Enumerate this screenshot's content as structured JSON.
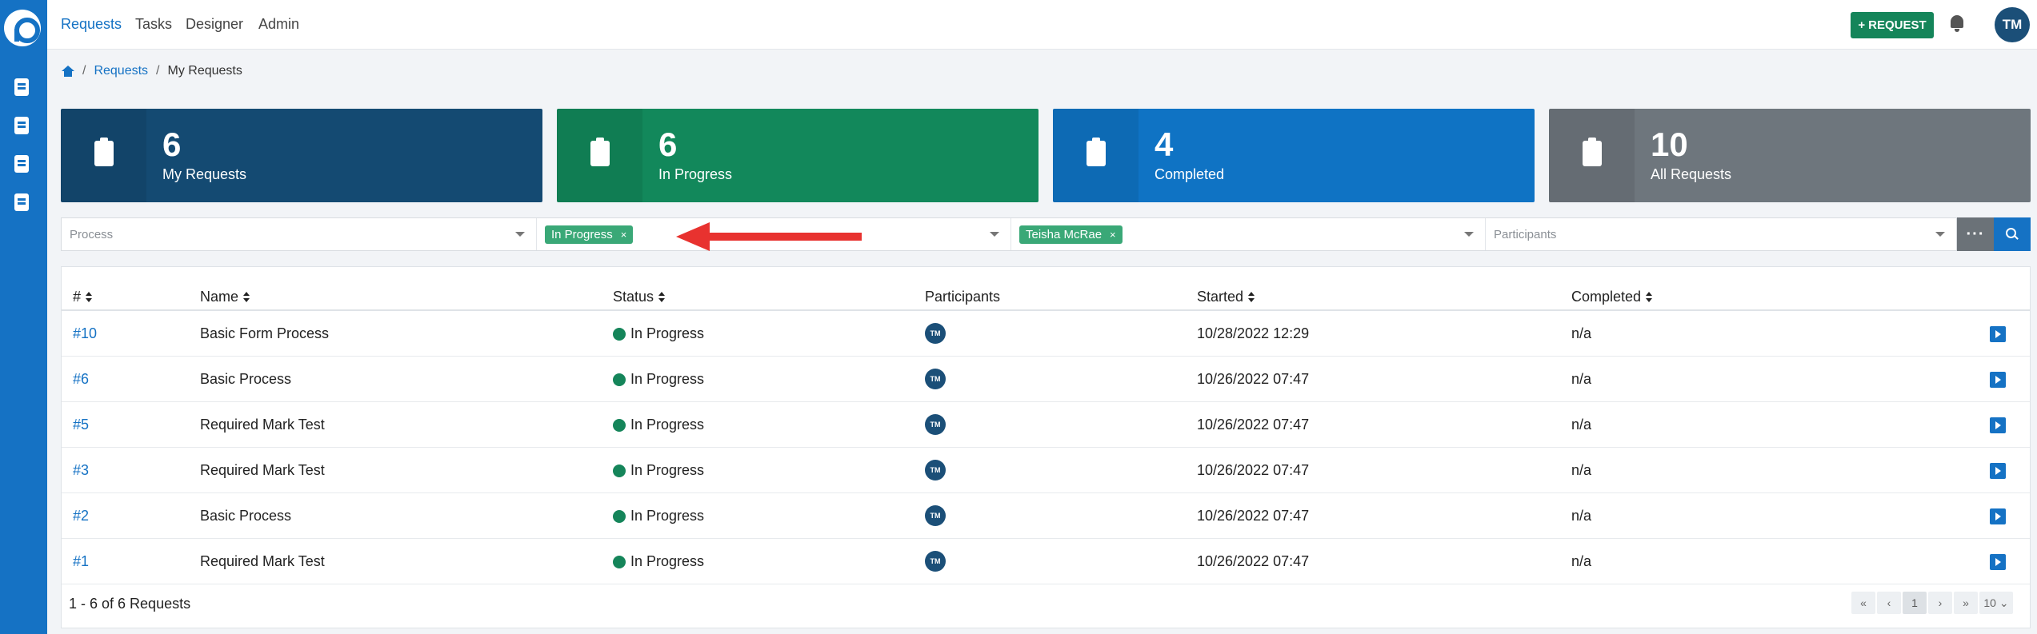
{
  "nav": {
    "items": [
      "Requests",
      "Tasks",
      "Designer",
      "Admin"
    ],
    "active": "Requests",
    "new_request_label": "REQUEST",
    "user_initials": "TM"
  },
  "breadcrumb": [
    "Requests",
    "My Requests"
  ],
  "cards": [
    {
      "count": "6",
      "label": "My Requests",
      "color": "#144a72"
    },
    {
      "count": "6",
      "label": "In Progress",
      "color": "#12885b"
    },
    {
      "count": "4",
      "label": "Completed",
      "color": "#0f73c4"
    },
    {
      "count": "10",
      "label": "All Requests",
      "color": "#6e767d"
    }
  ],
  "filters": {
    "process_placeholder": "Process",
    "status_chip": "In Progress",
    "requester_chip": "Teisha McRae",
    "participants_placeholder": "Participants"
  },
  "table": {
    "columns": [
      "#",
      "Name",
      "Status",
      "Participants",
      "Started",
      "Completed"
    ],
    "rows": [
      {
        "id": "#10",
        "name": "Basic Form Process",
        "status": "In Progress",
        "participant": "TM",
        "started": "10/28/2022 12:29",
        "completed": "n/a"
      },
      {
        "id": "#6",
        "name": "Basic Process",
        "status": "In Progress",
        "participant": "TM",
        "started": "10/26/2022 07:47",
        "completed": "n/a"
      },
      {
        "id": "#5",
        "name": "Required Mark Test",
        "status": "In Progress",
        "participant": "TM",
        "started": "10/26/2022 07:47",
        "completed": "n/a"
      },
      {
        "id": "#3",
        "name": "Required Mark Test",
        "status": "In Progress",
        "participant": "TM",
        "started": "10/26/2022 07:47",
        "completed": "n/a"
      },
      {
        "id": "#2",
        "name": "Basic Process",
        "status": "In Progress",
        "participant": "TM",
        "started": "10/26/2022 07:47",
        "completed": "n/a"
      },
      {
        "id": "#1",
        "name": "Required Mark Test",
        "status": "In Progress",
        "participant": "TM",
        "started": "10/26/2022 07:47",
        "completed": "n/a"
      }
    ],
    "summary": "1 - 6 of 6 Requests",
    "pagination": {
      "current_page": "1",
      "per_page": "10"
    }
  },
  "colors": {
    "primary": "#1572c4",
    "success": "#15855a",
    "chip": "#3aa877",
    "annotation_arrow": "#e8322f"
  }
}
